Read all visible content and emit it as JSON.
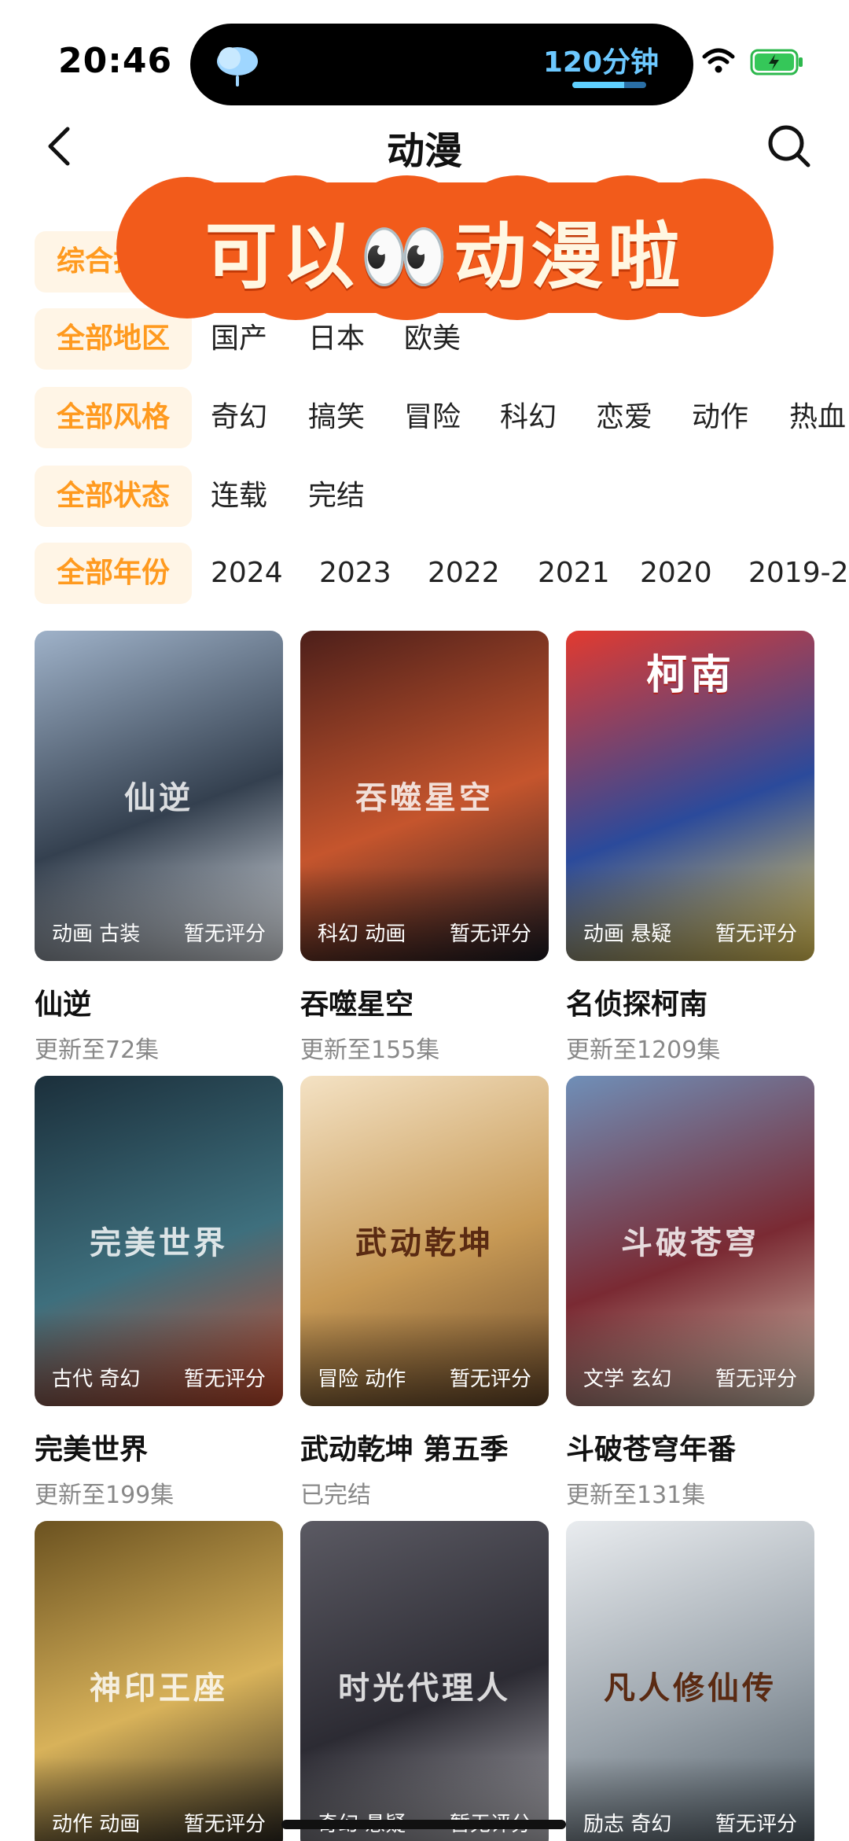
{
  "status": {
    "time": "20:46",
    "island_text": "120分钟",
    "island_progress": 0.7,
    "weather_icon": "cloud-rain-icon"
  },
  "header": {
    "title": "动漫"
  },
  "sticker": {
    "text_before": "可以",
    "text_after": "动漫啦",
    "emoji": "👀"
  },
  "filters": [
    {
      "chip": "综合排序",
      "options": []
    },
    {
      "chip": "全部地区",
      "options": [
        "国产",
        "日本",
        "欧美"
      ]
    },
    {
      "chip": "全部风格",
      "options": [
        "奇幻",
        "搞笑",
        "冒险",
        "科幻",
        "恋爱",
        "动作",
        "热血"
      ]
    },
    {
      "chip": "全部状态",
      "options": [
        "连载",
        "完结"
      ]
    },
    {
      "chip": "全部年份",
      "options": [
        "2024",
        "2023",
        "2022",
        "2021",
        "2020",
        "2019-2"
      ]
    }
  ],
  "cards": [
    {
      "tags": "动画 古装",
      "rating": "暂无评分",
      "name": "仙逆",
      "update": "更新至72集",
      "poster_text": "仙逆",
      "colors": [
        "#9fb2c9",
        "#34404f",
        "#e8ecf1"
      ]
    },
    {
      "tags": "科幻 动画",
      "rating": "暂无评分",
      "name": "吞噬星空",
      "update": "更新至155集",
      "poster_text": "吞噬星空",
      "colors": [
        "#4d1f1a",
        "#c5552d",
        "#1e1c24"
      ]
    },
    {
      "tags": "动画 悬疑",
      "rating": "暂无评分",
      "name": "名侦探柯南",
      "update": "更新至1209集",
      "poster_text": "柯南",
      "colors": [
        "#e23a2f",
        "#2b4a9b",
        "#f2d35a"
      ]
    },
    {
      "tags": "古代 奇幻",
      "rating": "暂无评分",
      "name": "完美世界",
      "update": "更新至199集",
      "poster_text": "完美世界",
      "colors": [
        "#1b2f3b",
        "#3e6f7d",
        "#c94a2b"
      ]
    },
    {
      "tags": "冒险 动作",
      "rating": "暂无评分",
      "name": "武动乾坤 第五季",
      "update": "已完结",
      "poster_text": "武动乾坤",
      "colors": [
        "#f4e2c4",
        "#c79955",
        "#6b4a2a"
      ]
    },
    {
      "tags": "文学 玄幻",
      "rating": "暂无评分",
      "name": "斗破苍穹年番",
      "update": "更新至131集",
      "poster_text": "斗破苍穹",
      "colors": [
        "#6f8fb8",
        "#7a2a33",
        "#d7c7b4"
      ]
    },
    {
      "tags": "动作 动画",
      "rating": "暂无评分",
      "name": "",
      "update": "",
      "poster_text": "神印王座",
      "colors": [
        "#6b5220",
        "#d8b25a",
        "#23201c"
      ]
    },
    {
      "tags": "奇幻 悬疑",
      "rating": "暂无评分",
      "name": "",
      "update": "",
      "poster_text": "时光代理人",
      "colors": [
        "#5b5a63",
        "#2c2b33",
        "#b8b7bd"
      ]
    },
    {
      "tags": "励志 奇幻",
      "rating": "暂无评分",
      "name": "",
      "update": "",
      "poster_text": "凡人修仙传",
      "colors": [
        "#e9ecef",
        "#9aa3ab",
        "#4e5a63"
      ]
    }
  ],
  "colors": {
    "accent": "#ff9a1f",
    "chip_bg": "#fff5e6",
    "sticker": "#f25b1b"
  }
}
